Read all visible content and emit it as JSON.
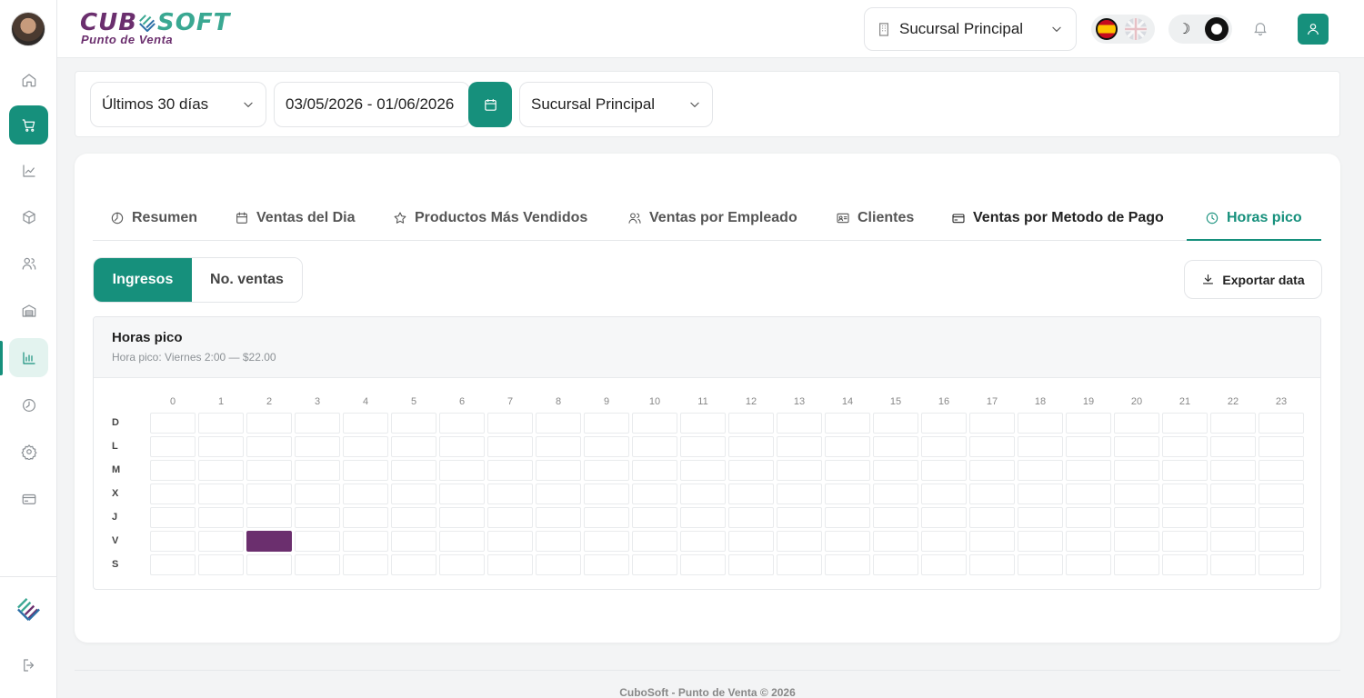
{
  "brand": {
    "name_part1": "CUB",
    "name_part2": "SOFT",
    "subtitle": "Punto de Venta"
  },
  "header": {
    "branch": "Sucursal Principal",
    "languages": [
      "es",
      "en"
    ],
    "theme": "dark"
  },
  "sidebar": {
    "items": [
      {
        "icon": "home-icon"
      },
      {
        "icon": "cart-icon",
        "active": true
      },
      {
        "icon": "trend-icon"
      },
      {
        "icon": "box-icon"
      },
      {
        "icon": "users-icon"
      },
      {
        "icon": "warehouse-icon"
      },
      {
        "icon": "report-icon",
        "selected": true
      },
      {
        "icon": "clock-icon"
      },
      {
        "icon": "settings-icon"
      },
      {
        "icon": "card-icon"
      }
    ]
  },
  "filters": {
    "period": "Últimos 30 días",
    "date_range": "03/05/2026 - 01/06/2026",
    "branch": "Sucursal Principal"
  },
  "tabs": [
    {
      "label": "Resumen"
    },
    {
      "label": "Ventas del Dia"
    },
    {
      "label": "Productos Más Vendidos"
    },
    {
      "label": "Ventas por Empleado"
    },
    {
      "label": "Clientes"
    },
    {
      "label": "Ventas por Metodo de Pago"
    },
    {
      "label": "Horas pico",
      "active": true
    }
  ],
  "toggle": {
    "on": "Ingresos",
    "off": "No. ventas"
  },
  "export_label": "Exportar data",
  "heatmap": {
    "title": "Horas pico",
    "subtitle": "Hora pico: Viernes 2:00 — $22.00",
    "hours": [
      "0",
      "1",
      "2",
      "3",
      "4",
      "5",
      "6",
      "7",
      "8",
      "9",
      "10",
      "11",
      "12",
      "13",
      "14",
      "15",
      "16",
      "17",
      "18",
      "19",
      "20",
      "21",
      "22",
      "23"
    ],
    "days": [
      "D",
      "L",
      "M",
      "X",
      "J",
      "V",
      "S"
    ],
    "hot_cells": [
      {
        "day": "V",
        "hour": 2,
        "value": 22.0
      }
    ],
    "hot_color": "#6b2f6e"
  },
  "footer": "CuboSoft - Punto de Venta © 2026",
  "colors": {
    "accent": "#16907c",
    "brand_purple": "#6b2f6e"
  }
}
